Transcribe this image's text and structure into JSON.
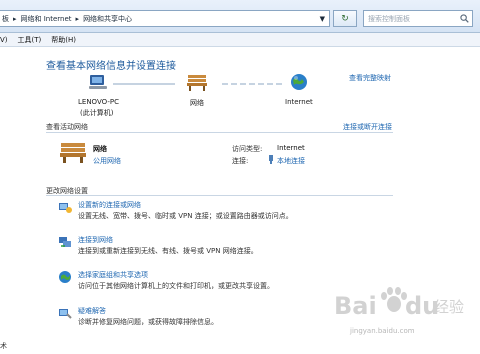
{
  "address_bar": {
    "crumbs": [
      "板",
      "网络和 Internet",
      "网络和共享中心"
    ],
    "search_placeholder": "搜索控制面板"
  },
  "menu_bar": {
    "items": [
      "V)",
      "工具(T)",
      "帮助(H)"
    ]
  },
  "main": {
    "title": "查看基本网络信息并设置连接",
    "full_map_link": "查看完整映射",
    "map": {
      "computer_name": "LENOVO-PC",
      "computer_note": "(此计算机)",
      "network_label": "网络",
      "internet_label": "Internet"
    },
    "active": {
      "heading": "查看活动网络",
      "connect_link": "连接或断开连接",
      "network_name": "网络",
      "network_type": "公用网络",
      "access_label": "访问类型:",
      "access_value": "Internet",
      "conn_label": "连接:",
      "conn_value": "本地连接"
    },
    "change": {
      "heading": "更改网络设置",
      "tasks": [
        {
          "title": "设置新的连接或网络",
          "desc": "设置无线、宽带、拨号、临时或 VPN 连接；或设置路由器或访问点。"
        },
        {
          "title": "连接到网络",
          "desc": "连接到或重新连接到无线、有线、拨号或 VPN 网络连接。"
        },
        {
          "title": "选择家庭组和共享选项",
          "desc": "访问位于其他网络计算机上的文件和打印机，或更改共享设置。"
        },
        {
          "title": "疑难解答",
          "desc": "诊断并修复网络问题，或获得故障排除信息。"
        }
      ]
    },
    "bottom_left": "术",
    "watermark_site": "jingyan.baidu.com"
  },
  "colors": {
    "link": "#1f67b1",
    "title": "#1d5a9c",
    "rule": "#c9d6e4"
  }
}
